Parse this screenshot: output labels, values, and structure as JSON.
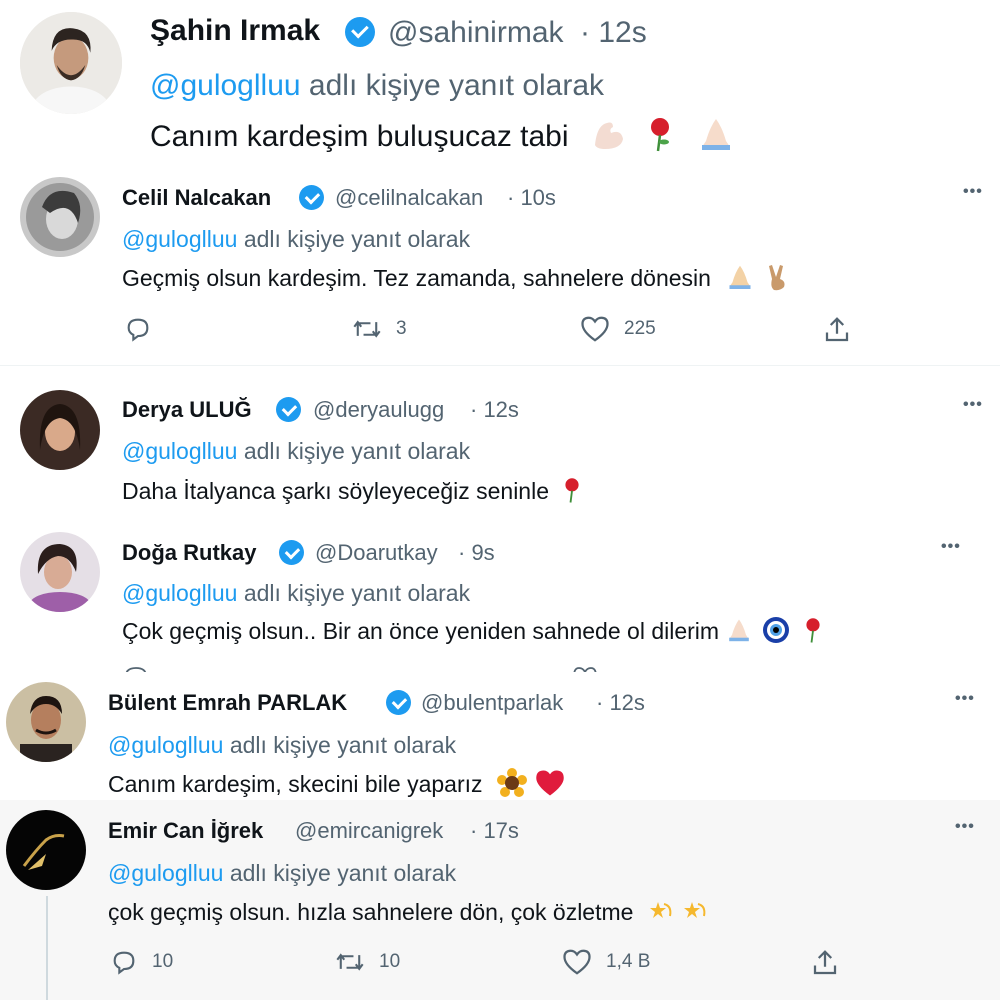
{
  "reply_prefix_mention": "@guloglluu",
  "reply_prefix_suffix": "adlı kişiye yanıt olarak",
  "more_glyph": "•••",
  "tweets": [
    {
      "name": "Şahin Irmak",
      "handle": "@sahinirmak",
      "time": "· 12s",
      "text": "Canım kardeşim buluşucaz tabi",
      "emojis": [
        "flexed-biceps-emoji",
        "rose-emoji",
        "folded-hands-emoji"
      ]
    },
    {
      "name": "Celil Nalcakan",
      "handle": "@celilnalcakan",
      "time": "· 10s",
      "text": "Geçmiş olsun kardeşim. Tez zamanda, sahnelere dönesin",
      "emojis": [
        "folded-hands-emoji",
        "victory-hand-emoji"
      ],
      "stats": {
        "replies": "",
        "retweets": "3",
        "likes": "225"
      }
    },
    {
      "name": "Derya ULUĞ",
      "handle": "@deryaulugg",
      "time": "· 12s",
      "text": "Daha İtalyanca şarkı söyleyeceğiz seninle",
      "emojis": [
        "rose-emoji"
      ]
    },
    {
      "name": "Doğa Rutkay",
      "handle": "@Doarutkay",
      "time": "· 9s",
      "text": "Çok geçmiş olsun.. Bir an önce yeniden sahnede ol dilerim",
      "emojis": [
        "folded-hands-emoji",
        "nazar-amulet-emoji",
        "rose-emoji"
      ]
    },
    {
      "name": "Bülent Emrah PARLAK",
      "handle": "@bulentparlak",
      "time": "· 12s",
      "text": "Canım kardeşim, skecini bile yaparız",
      "emojis": [
        "sunflower-emoji",
        "red-heart-emoji"
      ]
    },
    {
      "name": "Emir Can İğrek",
      "handle": "@emircanigrek",
      "time": "· 17s",
      "text": "çok geçmiş olsun. hızla sahnelere dön, çok özletme",
      "emojis": [
        "dizzy-star-emoji",
        "dizzy-star-emoji"
      ],
      "stats": {
        "replies": "10",
        "retweets": "10",
        "likes": "1,4 B"
      }
    }
  ],
  "colors": {
    "accent": "#1d9bf0",
    "muted": "#536471",
    "text": "#0f1419",
    "divider": "#eff3f4"
  }
}
